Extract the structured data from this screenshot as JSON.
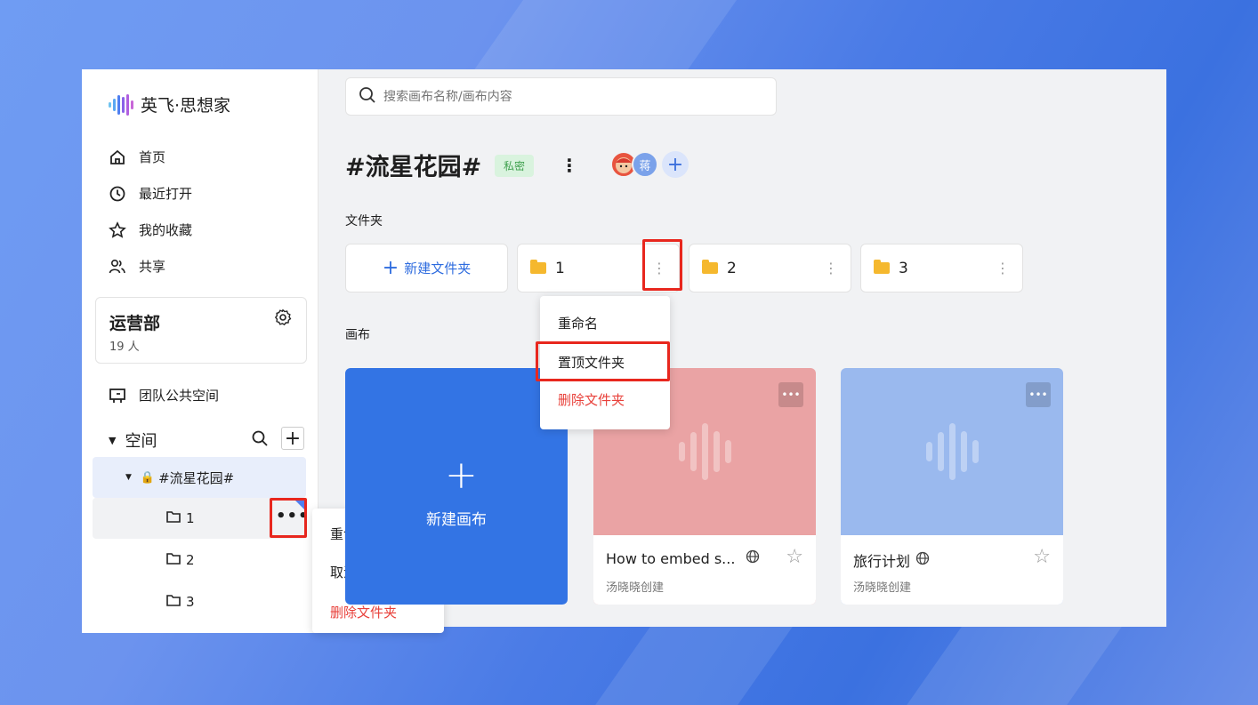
{
  "app": {
    "logo_text": "英飞·思想家"
  },
  "nav": [
    {
      "label": "首页",
      "icon": "home-icon"
    },
    {
      "label": "最近打开",
      "icon": "clock-icon"
    },
    {
      "label": "我的收藏",
      "icon": "star-icon"
    },
    {
      "label": "共享",
      "icon": "users-icon"
    }
  ],
  "team": {
    "name": "运营部",
    "count": "19 人"
  },
  "team_space": {
    "label": "团队公共空间"
  },
  "space": {
    "label": "空间",
    "root": "#流星花园#",
    "folders": [
      "1",
      "2",
      "3"
    ]
  },
  "sidebar_menu": {
    "rename": "重命名",
    "unpin": "取消置顶",
    "delete": "删除文件夹"
  },
  "search": {
    "placeholder": "搜索画布名称/画布内容"
  },
  "header": {
    "title": "#流星花园#",
    "badge": "私密",
    "kebab": "⋮",
    "avatar_text": "蒋",
    "add": "+"
  },
  "folders_section": {
    "label": "文件夹",
    "new_folder": "新建文件夹",
    "items": [
      "1",
      "2",
      "3"
    ]
  },
  "folder_menu": {
    "rename": "重命名",
    "pin": "置顶文件夹",
    "delete": "删除文件夹"
  },
  "canvas_section": {
    "label": "画布",
    "new_canvas": "新建画布"
  },
  "canvases": [
    {
      "title": "How to embed s...",
      "author": "汤晓晓创建",
      "color": "#eaa3a4"
    },
    {
      "title": "旅行计划",
      "author": "汤晓晓创建",
      "color": "#9ab9ee"
    }
  ],
  "colors": {
    "accent": "#3374e4",
    "danger": "#e8403a",
    "highlight_box": "#e8271e"
  }
}
